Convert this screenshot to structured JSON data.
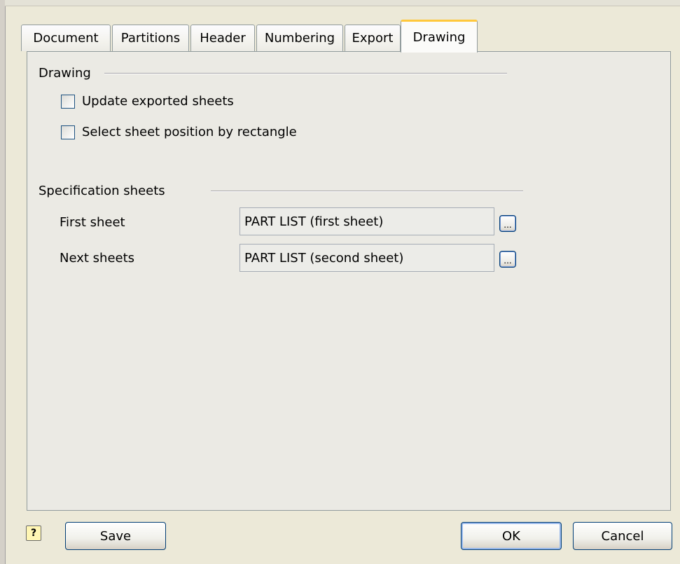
{
  "tabs": [
    "Document",
    "Partitions",
    "Header",
    "Numbering",
    "Export",
    "Drawing"
  ],
  "active_tab": "Drawing",
  "drawing_group": {
    "title": "Drawing",
    "options": [
      {
        "label": "Update exported sheets",
        "checked": false
      },
      {
        "label": "Select sheet position by rectangle",
        "checked": false
      }
    ]
  },
  "spec_group": {
    "title": "Specification sheets",
    "first_sheet": {
      "label": "First sheet",
      "value": "PART LIST (first sheet)",
      "browse": "..."
    },
    "next_sheets": {
      "label": "Next sheets",
      "value": "PART LIST (second sheet)",
      "browse": "..."
    }
  },
  "footer": {
    "help": "?",
    "save": "Save",
    "ok": "OK",
    "cancel": "Cancel"
  }
}
